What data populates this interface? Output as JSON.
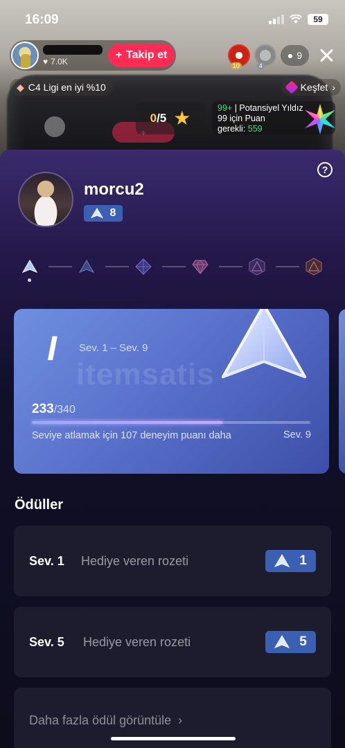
{
  "status_bar": {
    "time": "16:09",
    "battery": "59"
  },
  "live": {
    "host_likes": "7.0K",
    "follow_label": "Takip et",
    "viewer_badges": [
      "10",
      "4"
    ],
    "viewer_count": "9",
    "league_text": "C4 Ligi en iyi %10",
    "explore_label": "Keşfet",
    "quest_done": "0",
    "quest_total": "/5",
    "potential_rank": "99+",
    "potential_title": "Potansiyel Yıldız",
    "potential_line2": "99 için Puan",
    "potential_line3_prefix": "gerekli:",
    "potential_points": "559"
  },
  "sheet": {
    "username": "morcu2",
    "level": "8",
    "card": {
      "tier_roman": "I",
      "range": "Sev. 1 – Sev. 9",
      "xp_current": "233",
      "xp_max": "/340",
      "progress_fraction": 0.685,
      "xp_note": "Seviye atlamak için 107 deneyim puanı daha",
      "next_level": "Sev. 9",
      "watermark": "itemsatis"
    },
    "rewards_title": "Ödüller",
    "rewards": [
      {
        "level": "Sev. 1",
        "name": "Hediye veren rozeti",
        "badge_level": "1"
      },
      {
        "level": "Sev. 5",
        "name": "Hediye veren rozeti",
        "badge_level": "5"
      }
    ],
    "more_rewards": "Daha fazla ödül görüntüle"
  },
  "colors": {
    "accent_pink": "#fe2c55",
    "badge_blue": "#3b5fb3",
    "points_green": "#3ee07a"
  },
  "icons": [
    "shield-triangle-icon",
    "help-icon",
    "heart-icon",
    "plus-icon",
    "person-icon",
    "close-icon",
    "diamond-icon",
    "star-icon",
    "chevron-right-icon",
    "wifi-icon",
    "signal-icon"
  ]
}
